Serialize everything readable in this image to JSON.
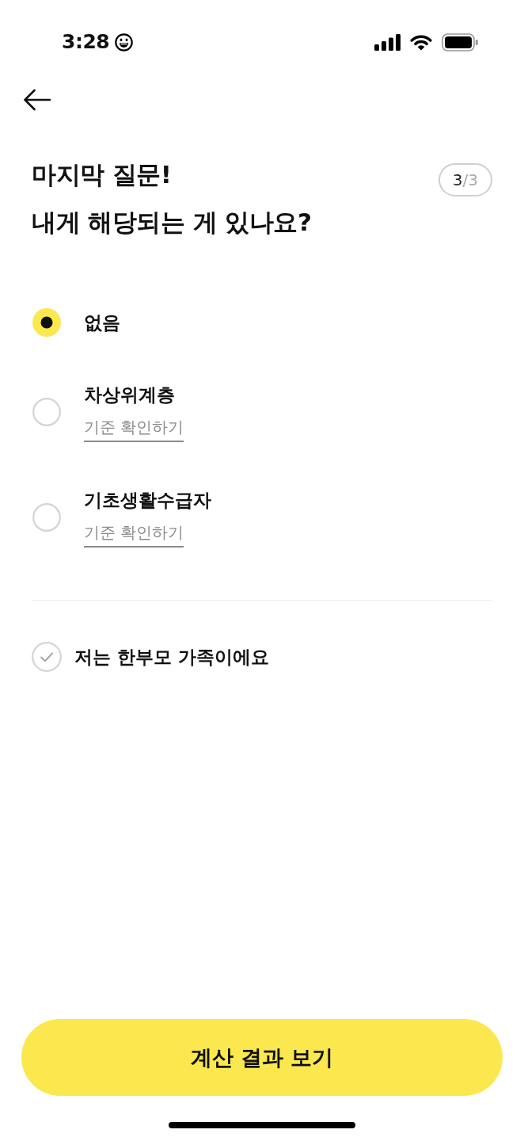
{
  "status_bar": {
    "time": "3:28"
  },
  "question": {
    "lines": [
      "마지막 질문!",
      "내게 해당되는 게 있나요?"
    ]
  },
  "step_counter": {
    "current": "3",
    "total": "/3"
  },
  "options": [
    {
      "label": "없음",
      "selected": true
    },
    {
      "label": "차상위계층",
      "selected": false,
      "link": "기준 확인하기"
    },
    {
      "label": "기초생활수급자",
      "selected": false,
      "link": "기준 확인하기"
    }
  ],
  "single_parent": {
    "label": "저는 한부모 가족이에요",
    "checked": false
  },
  "submit_button": {
    "label": "계산 결과 보기"
  }
}
